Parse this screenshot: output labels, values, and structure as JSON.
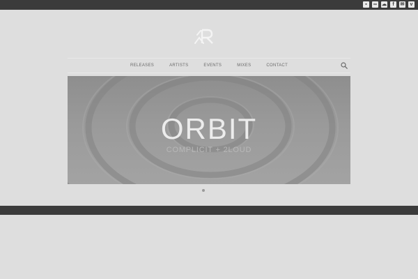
{
  "social": {
    "icons": [
      {
        "name": "square-icon",
        "glyph": "▪"
      },
      {
        "name": "link-icon",
        "glyph": "∞"
      },
      {
        "name": "soundcloud-icon",
        "glyph": "☁"
      },
      {
        "name": "facebook-icon",
        "glyph": "f"
      },
      {
        "name": "mail-icon",
        "glyph": "✉"
      },
      {
        "name": "vimeo-icon",
        "glyph": "v"
      }
    ]
  },
  "nav": {
    "items": [
      {
        "label": "RELEASES"
      },
      {
        "label": "ARTISTS"
      },
      {
        "label": "EVENTS"
      },
      {
        "label": "MIXES"
      },
      {
        "label": "CONTACT"
      }
    ]
  },
  "hero": {
    "title": "ORBIT",
    "subtitle": "COMPLICIT + 2LOUD"
  },
  "colors": {
    "topbar": "#3b3b3b",
    "background": "#dedede",
    "accent_text": "#ececec"
  }
}
